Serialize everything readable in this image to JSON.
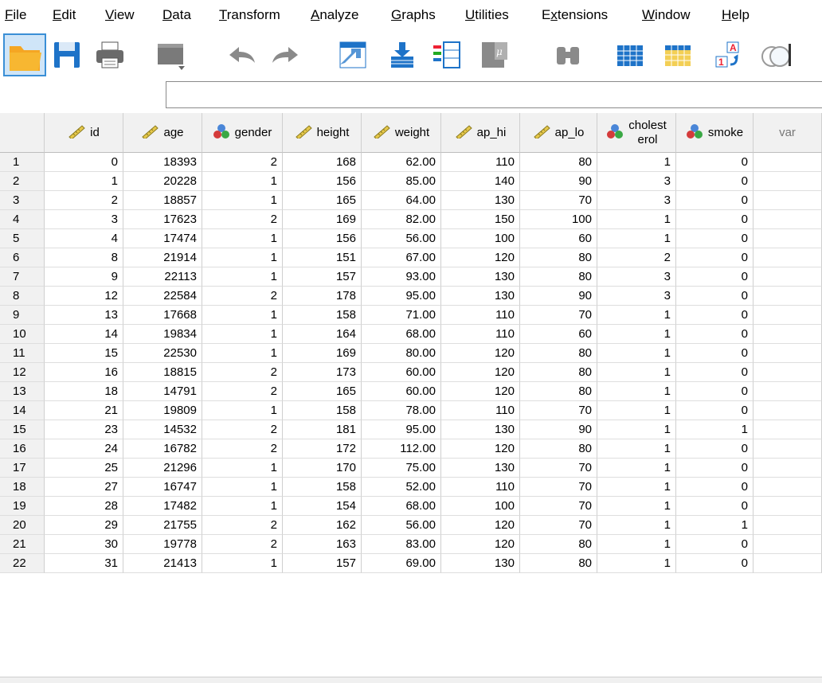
{
  "menu": [
    "File",
    "Edit",
    "View",
    "Data",
    "Transform",
    "Analyze",
    "Graphs",
    "Utilities",
    "Extensions",
    "Window",
    "Help"
  ],
  "toolbar_icons": [
    "open-folder-icon",
    "save-icon",
    "print-icon",
    "recall-dialog-icon",
    "undo-icon",
    "redo-icon",
    "goto-case-icon",
    "goto-variable-icon",
    "variables-icon",
    "descriptive-stats-icon",
    "find-icon",
    "insert-cases-icon",
    "insert-variable-icon",
    "split-file-icon",
    "value-labels-icon"
  ],
  "cell_editor": {
    "value": ""
  },
  "columns": [
    {
      "name": "id",
      "type": "scale"
    },
    {
      "name": "age",
      "type": "scale"
    },
    {
      "name": "gender",
      "type": "nominal"
    },
    {
      "name": "height",
      "type": "scale"
    },
    {
      "name": "weight",
      "type": "scale"
    },
    {
      "name": "ap_hi",
      "type": "scale"
    },
    {
      "name": "ap_lo",
      "type": "scale"
    },
    {
      "name": "cholest erol",
      "type": "nominal"
    },
    {
      "name": "smoke",
      "type": "nominal"
    },
    {
      "name": "var",
      "type": "empty"
    }
  ],
  "rows": [
    [
      "1",
      "0",
      "18393",
      "2",
      "168",
      "62.00",
      "110",
      "80",
      "1",
      "0"
    ],
    [
      "2",
      "1",
      "20228",
      "1",
      "156",
      "85.00",
      "140",
      "90",
      "3",
      "0"
    ],
    [
      "3",
      "2",
      "18857",
      "1",
      "165",
      "64.00",
      "130",
      "70",
      "3",
      "0"
    ],
    [
      "4",
      "3",
      "17623",
      "2",
      "169",
      "82.00",
      "150",
      "100",
      "1",
      "0"
    ],
    [
      "5",
      "4",
      "17474",
      "1",
      "156",
      "56.00",
      "100",
      "60",
      "1",
      "0"
    ],
    [
      "6",
      "8",
      "21914",
      "1",
      "151",
      "67.00",
      "120",
      "80",
      "2",
      "0"
    ],
    [
      "7",
      "9",
      "22113",
      "1",
      "157",
      "93.00",
      "130",
      "80",
      "3",
      "0"
    ],
    [
      "8",
      "12",
      "22584",
      "2",
      "178",
      "95.00",
      "130",
      "90",
      "3",
      "0"
    ],
    [
      "9",
      "13",
      "17668",
      "1",
      "158",
      "71.00",
      "110",
      "70",
      "1",
      "0"
    ],
    [
      "10",
      "14",
      "19834",
      "1",
      "164",
      "68.00",
      "110",
      "60",
      "1",
      "0"
    ],
    [
      "11",
      "15",
      "22530",
      "1",
      "169",
      "80.00",
      "120",
      "80",
      "1",
      "0"
    ],
    [
      "12",
      "16",
      "18815",
      "2",
      "173",
      "60.00",
      "120",
      "80",
      "1",
      "0"
    ],
    [
      "13",
      "18",
      "14791",
      "2",
      "165",
      "60.00",
      "120",
      "80",
      "1",
      "0"
    ],
    [
      "14",
      "21",
      "19809",
      "1",
      "158",
      "78.00",
      "110",
      "70",
      "1",
      "0"
    ],
    [
      "15",
      "23",
      "14532",
      "2",
      "181",
      "95.00",
      "130",
      "90",
      "1",
      "1"
    ],
    [
      "16",
      "24",
      "16782",
      "2",
      "172",
      "112.00",
      "120",
      "80",
      "1",
      "0"
    ],
    [
      "17",
      "25",
      "21296",
      "1",
      "170",
      "75.00",
      "130",
      "70",
      "1",
      "0"
    ],
    [
      "18",
      "27",
      "16747",
      "1",
      "158",
      "52.00",
      "110",
      "70",
      "1",
      "0"
    ],
    [
      "19",
      "28",
      "17482",
      "1",
      "154",
      "68.00",
      "100",
      "70",
      "1",
      "0"
    ],
    [
      "20",
      "29",
      "21755",
      "2",
      "162",
      "56.00",
      "120",
      "70",
      "1",
      "1"
    ],
    [
      "21",
      "30",
      "19778",
      "2",
      "163",
      "83.00",
      "120",
      "80",
      "1",
      "0"
    ],
    [
      "22",
      "31",
      "21413",
      "1",
      "157",
      "69.00",
      "130",
      "80",
      "1",
      "0"
    ]
  ],
  "colors": {
    "header_bg": "#f1f1f1",
    "grid_line": "#cfcfcf",
    "toolbar_blue": "#1e73c8",
    "highlight_border": "#3a8fd6"
  }
}
